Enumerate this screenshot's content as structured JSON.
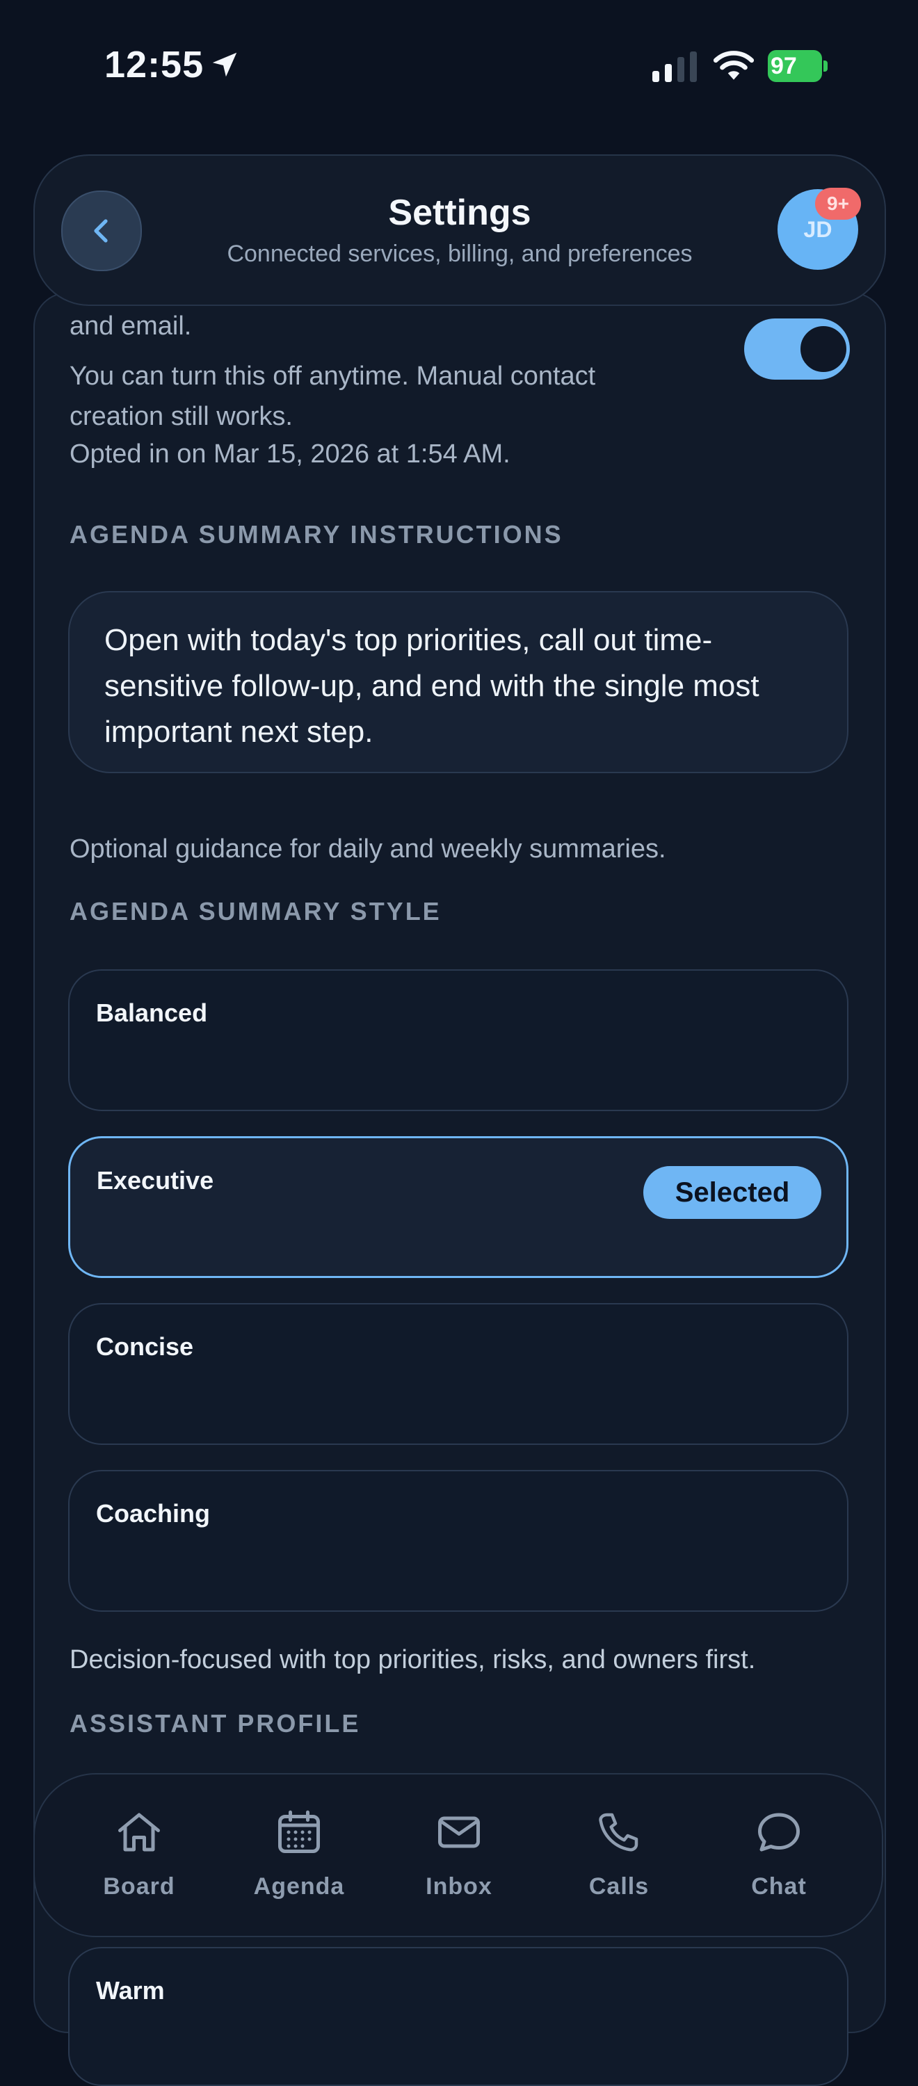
{
  "status_bar": {
    "time": "12:55",
    "battery": "97"
  },
  "header": {
    "title": "Settings",
    "subtitle": "Connected services, billing, and preferences",
    "avatar_initials": "JD",
    "notification_badge": "9+"
  },
  "contacts_optin": {
    "cut_text": "and email.",
    "note": "You can turn this off anytime. Manual contact creation still works.",
    "opted_in": "Opted in on Mar 15, 2026 at 1:54 AM.",
    "toggle_on": true
  },
  "agenda_instructions": {
    "heading": "AGENDA SUMMARY INSTRUCTIONS",
    "text": "Open with today's top priorities, call out time-sensitive follow-up, and end with the single most important next step.",
    "helper": "Optional guidance for daily and weekly summaries."
  },
  "agenda_style": {
    "heading": "AGENDA SUMMARY STYLE",
    "options": [
      {
        "label": "Balanced"
      },
      {
        "label": "Executive",
        "selected_label": "Selected"
      },
      {
        "label": "Concise"
      },
      {
        "label": "Coaching"
      }
    ],
    "selected_index": 1,
    "description": "Decision-focused with top priorities, risks, and owners first."
  },
  "assistant_profile": {
    "heading": "ASSISTANT PROFILE",
    "first_option": "Warm"
  },
  "tabs": [
    {
      "label": "Board",
      "icon": "home-icon"
    },
    {
      "label": "Agenda",
      "icon": "calendar-icon"
    },
    {
      "label": "Inbox",
      "icon": "mail-icon"
    },
    {
      "label": "Calls",
      "icon": "phone-icon"
    },
    {
      "label": "Chat",
      "icon": "chat-bubble-icon"
    }
  ],
  "colors": {
    "background": "#0b1220",
    "accent": "#6fb6f4",
    "badge": "#f06a6a",
    "battery": "#34c759"
  }
}
